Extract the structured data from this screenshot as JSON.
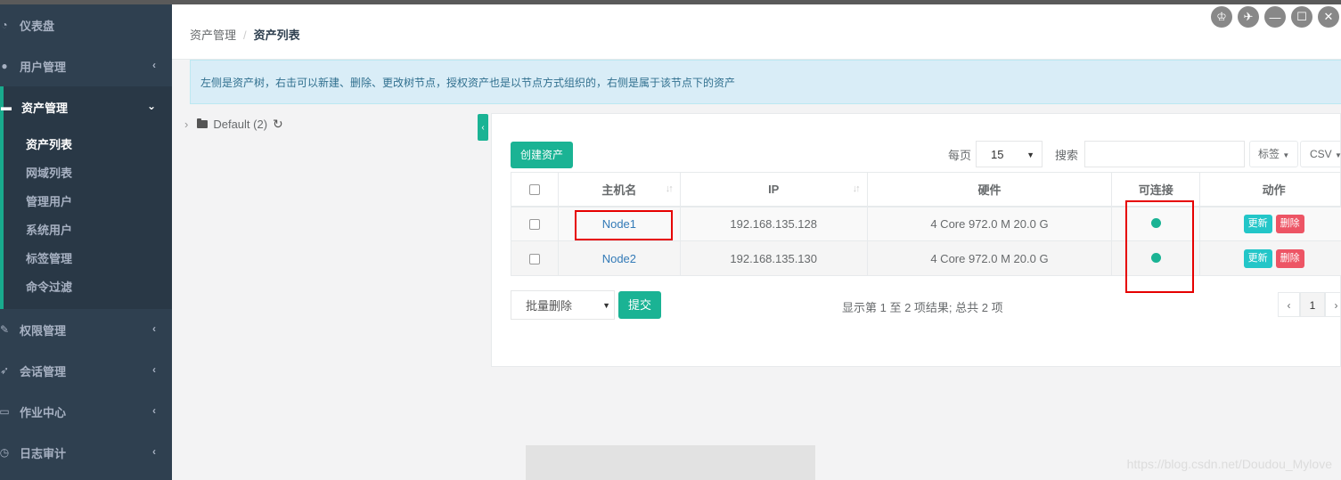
{
  "sidebar": {
    "items": [
      {
        "label": "仪表盘",
        "icon": "dashboard-icon"
      },
      {
        "label": "用户管理",
        "icon": "users-icon",
        "arrow": "‹"
      },
      {
        "label": "资产管理",
        "icon": "inbox-icon",
        "arrow": "⌄",
        "active": true
      },
      {
        "label": "权限管理",
        "icon": "edit-icon",
        "arrow": "‹"
      },
      {
        "label": "会话管理",
        "icon": "rocket-icon",
        "arrow": "‹"
      },
      {
        "label": "作业中心",
        "icon": "tasks-icon",
        "arrow": "‹"
      },
      {
        "label": "日志审计",
        "icon": "history-icon",
        "arrow": "‹"
      }
    ],
    "subitems": [
      "资产列表",
      "网域列表",
      "管理用户",
      "系统用户",
      "标签管理",
      "命令过滤"
    ]
  },
  "breadcrumb": {
    "parent": "资产管理",
    "separator": "/",
    "current": "资产列表"
  },
  "alert_text": "左侧是资产树，右击可以新建、删除、更改树节点，授权资产也是以节点方式组织的，右侧是属于该节点下的资产",
  "tree": {
    "node_label": "Default (2)"
  },
  "toolbar": {
    "create_label": "创建资产",
    "per_page_label": "每页",
    "per_page_value": "15",
    "search_label": "搜索",
    "search_value": "",
    "tags_label": "标签",
    "csv_label": "CSV"
  },
  "table": {
    "headers": [
      "主机名",
      "IP",
      "硬件",
      "可连接",
      "动作"
    ],
    "rows": [
      {
        "hostname": "Node1",
        "ip": "192.168.135.128",
        "hardware": "4 Core 972.0 M 20.0 G",
        "connectable": true,
        "update": "更新",
        "delete": "删除"
      },
      {
        "hostname": "Node2",
        "ip": "192.168.135.130",
        "hardware": "4 Core 972.0 M 20.0 G",
        "connectable": true,
        "update": "更新",
        "delete": "删除"
      }
    ]
  },
  "footer": {
    "bulk_action": "批量删除",
    "submit_label": "提交",
    "summary": "显示第 1 至 2 项结果; 总共 2 项",
    "pager": {
      "prev": "‹",
      "page": "1",
      "next": "›"
    }
  },
  "watermark": "https://blog.csdn.net/Doudou_Mylove",
  "colors": {
    "primary": "#1ab394",
    "sidebar": "#2f4050",
    "info": "#23c6c8",
    "danger": "#ed5565",
    "annotation": "#e60000"
  }
}
